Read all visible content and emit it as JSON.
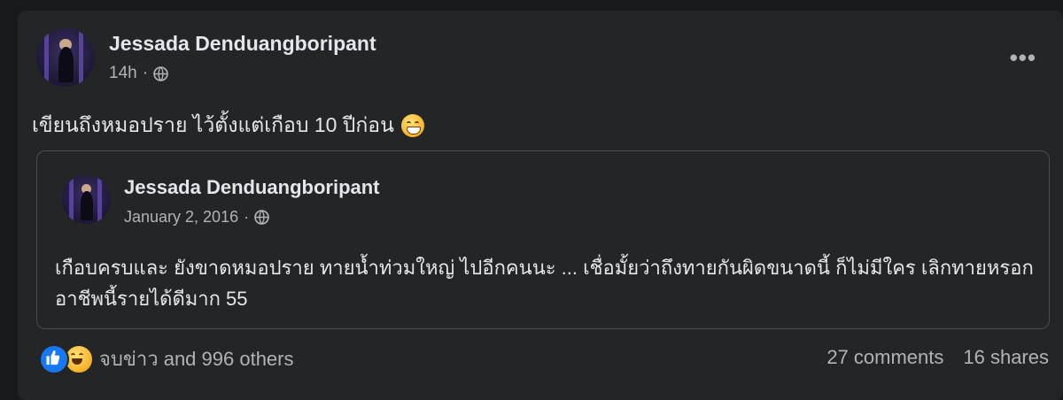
{
  "post": {
    "author": "Jessada Denduangboripant",
    "time": "14h",
    "separator": "·",
    "privacy_icon": "globe-icon",
    "more_label": "•••",
    "text": "เขียนถึงหมอปราย ไว้ตั้งแต่เกือบ 10 ปีก่อน",
    "emoji": "grinning-face"
  },
  "shared_post": {
    "author": "Jessada Denduangboripant",
    "date": "January 2, 2016",
    "separator": "·",
    "privacy_icon": "globe-icon",
    "text": "เกือบครบและ ยังขาดหมอปราย ทายน้ำท่วมใหญ่ ไปอีกคนนะ ... เชื่อมั้ยว่าถึงทายกันผิดขนาดนี้ ก็ไม่มีใคร เลิกทายหรอก อาชีพนี้รายได้ดีมาก 55"
  },
  "footer": {
    "reaction_icons": [
      "like-icon",
      "haha-icon"
    ],
    "reactions_text": "จบข่าว and 996 others",
    "comments": "27 comments",
    "shares": "16 shares"
  },
  "colors": {
    "background": "#18191a",
    "card": "#242526",
    "text_primary": "#e4e6eb",
    "text_secondary": "#b0b3b8",
    "like_blue": "#1877f2"
  }
}
